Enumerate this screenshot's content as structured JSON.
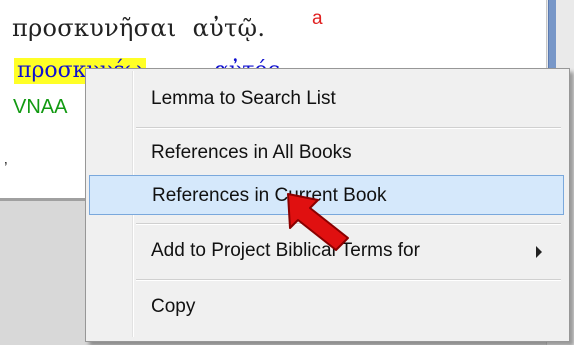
{
  "text_pane": {
    "greek_word_1": "προσκυνῆσαι",
    "greek_word_2": "αὐτῷ.",
    "footnote_marker": "a",
    "lexical_form_1": "προσκυνέω",
    "lexical_form_2": "αὐτός",
    "parse_code": "VNAA",
    "small_mark": "’"
  },
  "context_menu": {
    "items": [
      {
        "label": "Lemma to Search List"
      },
      {
        "label": "References in All Books"
      },
      {
        "label": "References in Current Book",
        "state": "hovered"
      },
      {
        "label": "Add to Project Biblical Terms for",
        "has_submenu": true
      },
      {
        "label": "Copy"
      }
    ]
  },
  "colors": {
    "highlight": "#ffff26",
    "footnote": "#e02020",
    "lexical": "#1010d0",
    "parse": "#129a12",
    "menu_hover": "#d5e8fb",
    "pointer": "#e01010"
  },
  "icons": {
    "submenu": "chevron-right-icon",
    "annotation": "red-arrow-pointer-icon"
  }
}
